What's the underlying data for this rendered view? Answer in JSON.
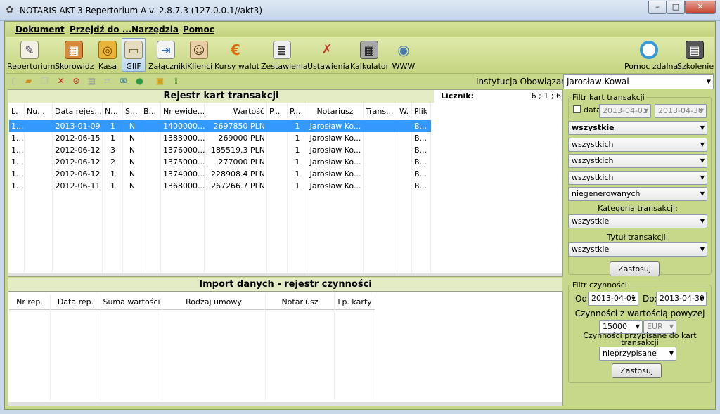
{
  "window": {
    "title": "NOTARIS AKT-3 Repertorium A v. 2.8.7.3 (127.0.0.1//akt3)",
    "min": "–",
    "max": "□",
    "close": "✕"
  },
  "menu": {
    "dokument": "Dokument",
    "przejdz": "Przejdź do ...",
    "narzedzia": "Narzędzia",
    "pomoc": "Pomoc"
  },
  "toolbar": {
    "repertorium": "Repertorium",
    "skorowidz": "Skorowidz",
    "kasa": "Kasa",
    "giif": "GIIF",
    "zalaczniki": "Załączniki",
    "klienci": "Klienci",
    "kursy": "Kursy walut",
    "zestawienia": "Zestawienia",
    "ustawienia": "Ustawienia",
    "kalkulator": "Kalkulator",
    "www": "WWW",
    "pomoc_zdalna": "Pomoc zdalna",
    "szkolenie": "Szkolenie"
  },
  "icons": {
    "euro": "€",
    "www": "◉"
  },
  "institution": {
    "label": "Instytucja Obowiązana:",
    "value": "Jarosław Kowal"
  },
  "register": {
    "title": "Rejestr kart transakcji",
    "counter_label": "Licznik:",
    "counter_value": "6 ; 1 ; 6",
    "columns": [
      "L.",
      "Nu...",
      "Data rejes...",
      "N...",
      "S...",
      "B...",
      "Nr ewide...",
      "Wartość",
      "P...",
      "P...",
      "Notariusz",
      "Trans...",
      "W.",
      "Plik"
    ],
    "rows": [
      [
        "1...",
        "",
        "2013-01-09",
        "1",
        "N",
        "",
        "1400000...",
        "2697850 PLN",
        "",
        "1",
        "Jarosław Ko...",
        "",
        "",
        "B..."
      ],
      [
        "1...",
        "",
        "2012-06-15",
        "1",
        "N",
        "",
        "1383000...",
        "269000 PLN",
        "",
        "1",
        "Jarosław Ko...",
        "",
        "",
        "B..."
      ],
      [
        "1...",
        "",
        "2012-06-12",
        "3",
        "N",
        "",
        "1376000...",
        "185519.3 PLN",
        "",
        "1",
        "Jarosław Ko...",
        "",
        "",
        "B..."
      ],
      [
        "1...",
        "",
        "2012-06-12",
        "2",
        "N",
        "",
        "1375000...",
        "277000 PLN",
        "",
        "1",
        "Jarosław Ko...",
        "",
        "",
        "B..."
      ],
      [
        "1...",
        "",
        "2012-06-12",
        "1",
        "N",
        "",
        "1374000...",
        "228908.4 PLN",
        "",
        "1",
        "Jarosław Ko...",
        "",
        "",
        "B..."
      ],
      [
        "1...",
        "",
        "2012-06-11",
        "1",
        "N",
        "",
        "1368000...",
        "267266.7 PLN",
        "",
        "1",
        "Jarosław Ko...",
        "",
        "",
        "B..."
      ]
    ]
  },
  "import": {
    "title": "Import danych - rejestr czynności",
    "columns": [
      "Nr rep.",
      "Data rep.",
      "Suma wartości",
      "Rodzaj umowy",
      "Notariusz",
      "Lp. karty"
    ]
  },
  "filter_cards": {
    "title": "Filtr kart transakcji",
    "date_label": "data",
    "date_from": "2013-04-01",
    "date_to": "2013-04-30",
    "combo1": "wszystkie",
    "combo2": "wszystkich",
    "combo3": "wszystkich",
    "combo4": "wszystkich",
    "combo5": "niegenerowanych",
    "category_label": "Kategoria transakcji:",
    "category_value": "wszystkie",
    "title_label": "Tytuł transakcji:",
    "title_value": "wszystkie",
    "apply": "Zastosuj"
  },
  "filter_actions": {
    "title": "Filtr czynności",
    "from_label": "Od:",
    "from_value": "2013-04-01",
    "to_label": "Do:",
    "to_value": "2013-04-30",
    "value_label": "Czynności z wartością powyżej",
    "amount": "15000",
    "currency": "EUR",
    "assigned_label": "Czynności przypisane do kart transakcji",
    "assigned_value": "nieprzypisane",
    "apply": "Zastosuj"
  }
}
